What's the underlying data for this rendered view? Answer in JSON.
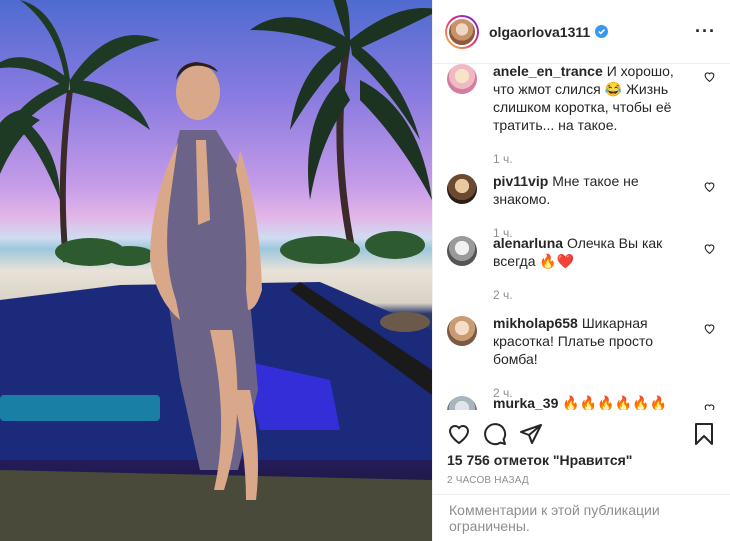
{
  "post": {
    "username": "olgaorlova1311",
    "more_icon": "more-options-icon",
    "likes_text": "15 756 отметок \"Нравится\"",
    "posted_ago": "2 часов назад",
    "comments_restricted": "Комментарии к этой публикации ограничены.",
    "brand_color_verified": "#3897f0"
  },
  "comments": [
    {
      "user": "anele_en_trance",
      "text": "И хорошо, что жмот слился 😂 Жизнь слишком коротка, чтобы её тратить... на такое.",
      "time": "1 ч."
    },
    {
      "user": "piv11vip",
      "text": "Мне такое не знакомо.",
      "time": "1 ч."
    },
    {
      "user": "alenarluna",
      "text": "Олечка Вы как всегда 🔥❤️",
      "time": "2 ч."
    },
    {
      "user": "mikholap658",
      "text": "Шикарная красотка! Платье просто бомба!",
      "time": "2 ч."
    },
    {
      "user": "murka_39",
      "text": "🔥🔥🔥🔥🔥🔥",
      "time": ""
    }
  ]
}
